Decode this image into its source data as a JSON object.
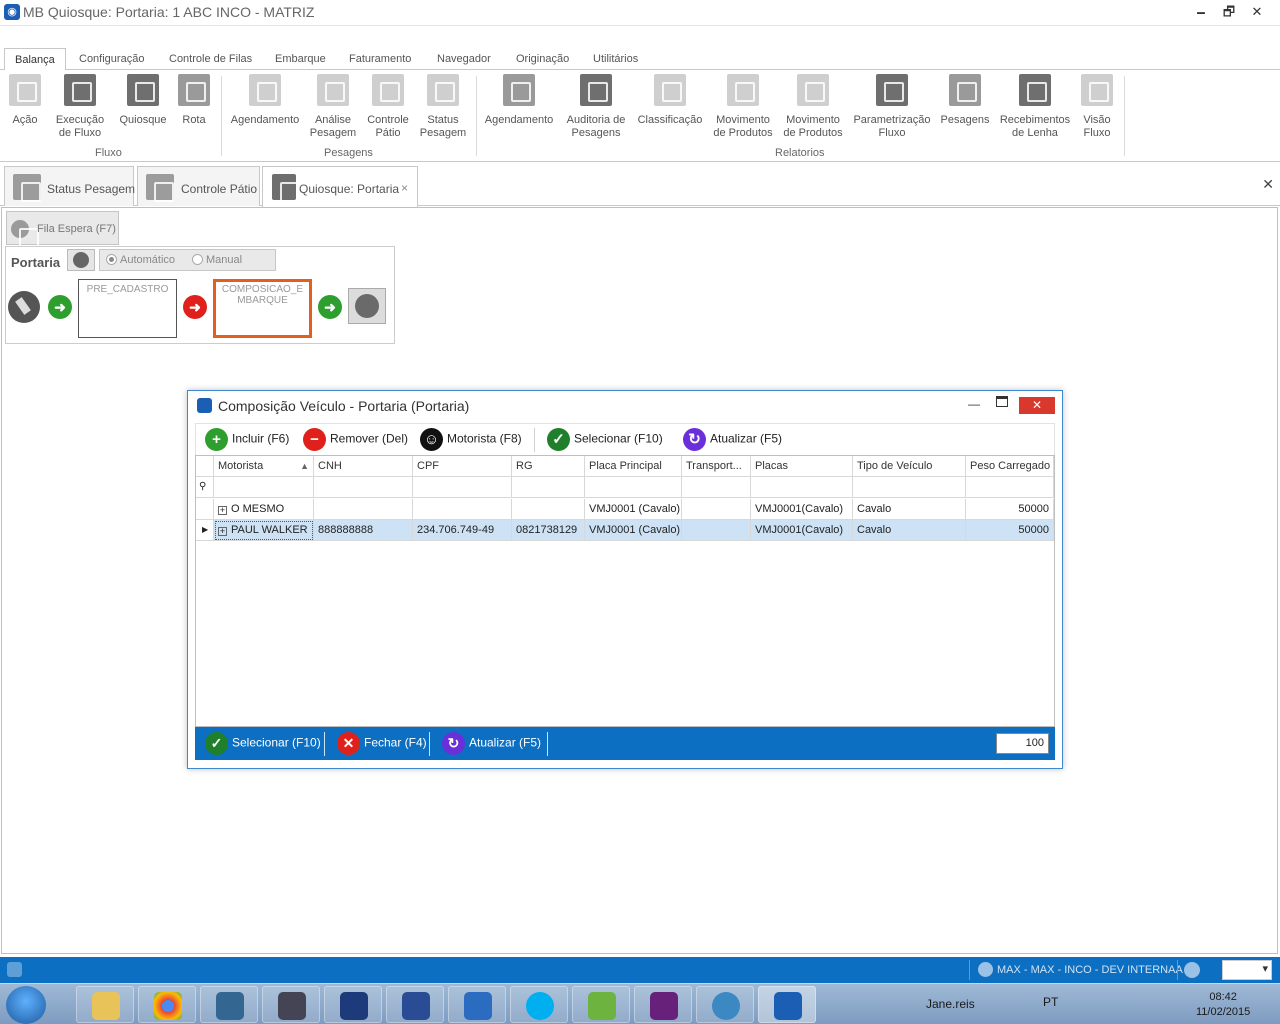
{
  "window": {
    "title": "MB Quiosque: Portaria: 1 ABC INCO - MATRIZ",
    "minimize": "🗕",
    "restore": "🗗",
    "close": "✕"
  },
  "ribbon": {
    "tabs": [
      "Balança",
      "Configuração",
      "Controle de Filas",
      "Embarque",
      "Faturamento",
      "Navegador",
      "Originação",
      "Utilitários"
    ],
    "groups": {
      "fluxo": {
        "label": "Fluxo",
        "buttons": [
          "Ação",
          "Execução de Fluxo",
          "Quiosque",
          "Rota"
        ]
      },
      "pesagens": {
        "label": "Pesagens",
        "buttons": [
          "Agendamento",
          "Análise Pesagem",
          "Controle Pátio",
          "Status Pesagem"
        ]
      },
      "relatorios": {
        "label": "Relatorios",
        "buttons": [
          "Agendamento",
          "Auditoria de Pesagens",
          "Classificação",
          "Movimento de Produtos",
          "Movimento de Produtos",
          "Parametrização Fluxo",
          "Pesagens",
          "Recebimentos de Lenha",
          "Visão Fluxo"
        ]
      }
    }
  },
  "doc_tabs": {
    "tab1": "Status Pesagem",
    "tab2": "Controle Pátio",
    "tab3": "Quiosque: Portaria",
    "close_tab": "×",
    "close_all": "✕"
  },
  "main": {
    "fila_button": "Fila Espera (F7)",
    "portaria": {
      "title": "Portaria",
      "mode_auto": "Automático",
      "mode_manual": "Manual",
      "stage1": "PRE_CADASTRO",
      "stage2": "COMPOSICAO_EMBARQUE"
    }
  },
  "dialog": {
    "title": "Composição Veículo - Portaria (Portaria)",
    "toolbar": {
      "incluir": "Incluir (F6)",
      "remover": "Remover (Del)",
      "motorista": "Motorista (F8)",
      "selecionar": "Selecionar (F10)",
      "atualizar": "Atualizar (F5)"
    },
    "grid": {
      "columns": [
        "Motorista",
        "CNH",
        "CPF",
        "RG",
        "Placa Principal",
        "Transport...",
        "Placas",
        "Tipo de Veículo",
        "Peso Carregado"
      ],
      "filter_icon": "⚲",
      "rows": [
        {
          "motorista": "O MESMO",
          "cnh": "",
          "cpf": "",
          "rg": "",
          "placa": "VMJ0001 (Cavalo)",
          "transport": "",
          "placas": "VMJ0001(Cavalo)",
          "tipo": "Cavalo",
          "peso": "50000"
        },
        {
          "motorista": "PAUL WALKER",
          "cnh": "888888888",
          "cpf": "234.706.749-49",
          "rg": "0821738129",
          "placa": "VMJ0001 (Cavalo)",
          "transport": "",
          "placas": "VMJ0001(Cavalo)",
          "tipo": "Cavalo",
          "peso": "50000"
        }
      ]
    },
    "footer": {
      "selecionar": "Selecionar (F10)",
      "fechar": "Fechar (F4)",
      "atualizar": "Atualizar (F5)",
      "count": "100"
    }
  },
  "statusbar": {
    "user": "MAX - MAX - INCO - DEV INTERNAA"
  },
  "taskbar": {
    "tray_user": "Jane.reis",
    "lang": "PT",
    "time": "08:42",
    "date": "11/02/2015"
  },
  "colors": {
    "accent_blue": "#0c6fc2",
    "add_green": "#2e9e2e",
    "remove_red": "#e0201a",
    "refresh_purple": "#6a2fd8",
    "active_stage_orange": "#e0601f"
  }
}
